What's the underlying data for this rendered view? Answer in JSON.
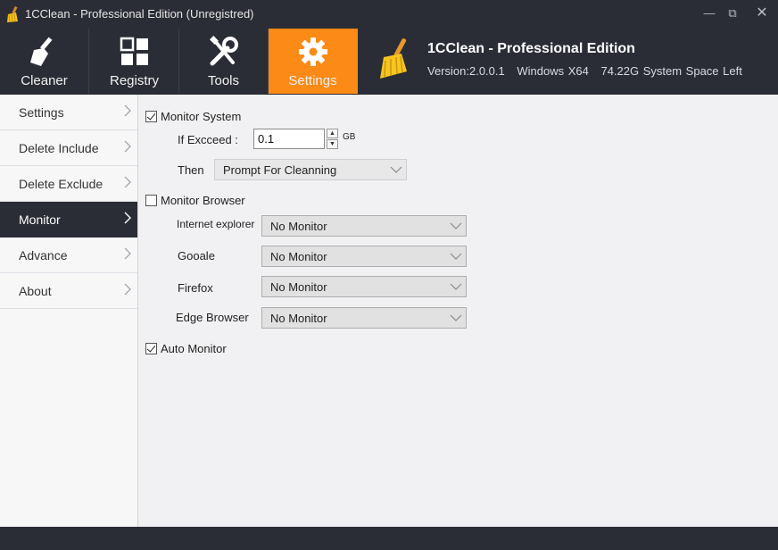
{
  "window": {
    "title": "1CClean - Professional Edition (Unregistred)",
    "minimize_glyph": "—",
    "restore_glyph": "⧉",
    "close_glyph": "✕"
  },
  "toolbar": {
    "tabs": [
      {
        "label": "Cleaner",
        "icon": "broom-icon"
      },
      {
        "label": "Registry",
        "icon": "grid-icon"
      },
      {
        "label": "Tools",
        "icon": "tools-icon"
      },
      {
        "label": "Settings",
        "icon": "gear-icon",
        "active": true
      }
    ],
    "brand_title": "1CClean - Professional Edition",
    "version": "Version:2.0.0.1",
    "os": "Windows X64",
    "space": "74.22G System Space Left"
  },
  "sidebar": {
    "items": [
      {
        "label": "Settings"
      },
      {
        "label": "Delete Include"
      },
      {
        "label": "Delete Exclude"
      },
      {
        "label": "Monitor",
        "active": true
      },
      {
        "label": "Advance"
      },
      {
        "label": "About"
      }
    ]
  },
  "monitor": {
    "monitor_system": {
      "label": "Monitor System",
      "checked": true
    },
    "if_exceed_label": "If Excceed :",
    "if_exceed_value": "0.1",
    "unit": "GB",
    "then_label": "Then",
    "then_value": "Prompt For Cleanning",
    "monitor_browser": {
      "label": "Monitor Browser",
      "checked": false
    },
    "browsers": [
      {
        "name": "Internet explorer",
        "value": "No Monitor"
      },
      {
        "name": "Gooale",
        "value": "No Monitor"
      },
      {
        "name": "Firefox",
        "value": "No Monitor"
      },
      {
        "name": "Edge Browser",
        "value": "No Monitor"
      }
    ],
    "auto_monitor": {
      "label": "Auto Monitor",
      "checked": true
    }
  },
  "colors": {
    "dark": "#2b2d36",
    "accent": "#fb8a16",
    "panel": "#f1f1f3"
  }
}
